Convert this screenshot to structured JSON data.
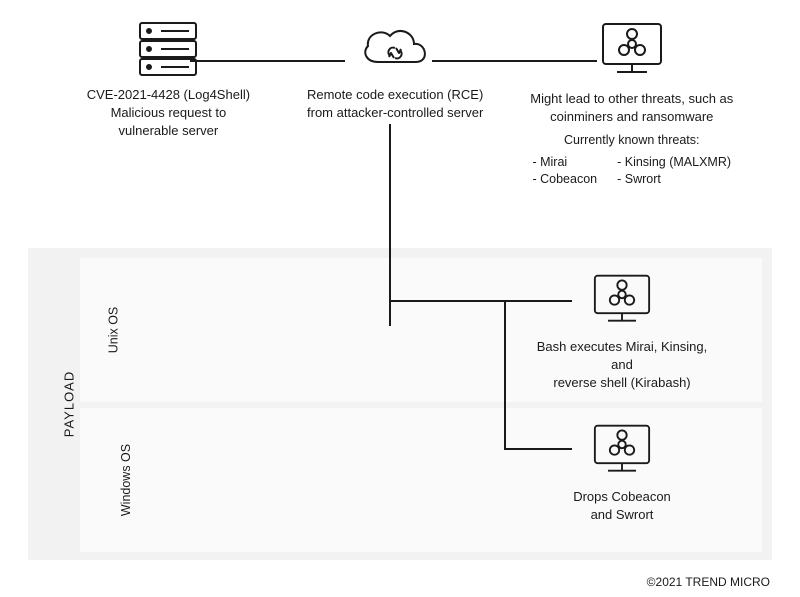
{
  "top": {
    "server": {
      "line1": "CVE-2021-4428 (Log4Shell)",
      "line2": "Malicious request to",
      "line3": "vulnerable server"
    },
    "cloud": {
      "line1": "Remote code execution (RCE)",
      "line2": "from attacker-controlled server"
    },
    "threats": {
      "line1": "Might lead to other threats, such as",
      "line2": "coinminers and ransomware",
      "known_label": "Currently known threats:",
      "col1_a": "- Mirai",
      "col1_b": "- Cobeacon",
      "col2_a": "- Kinsing (MALXMR)",
      "col2_b": "- Swrort"
    }
  },
  "payload": {
    "label": "PAYLOAD",
    "unix": {
      "label": "Unix OS",
      "line1": "Bash executes Mirai, Kinsing, and",
      "line2": "reverse shell (Kirabash)"
    },
    "windows": {
      "label": "Windows OS",
      "line1": "Drops Cobeacon",
      "line2": "and Swrort"
    }
  },
  "footer": {
    "copyright": "©2021 TREND MICRO"
  }
}
